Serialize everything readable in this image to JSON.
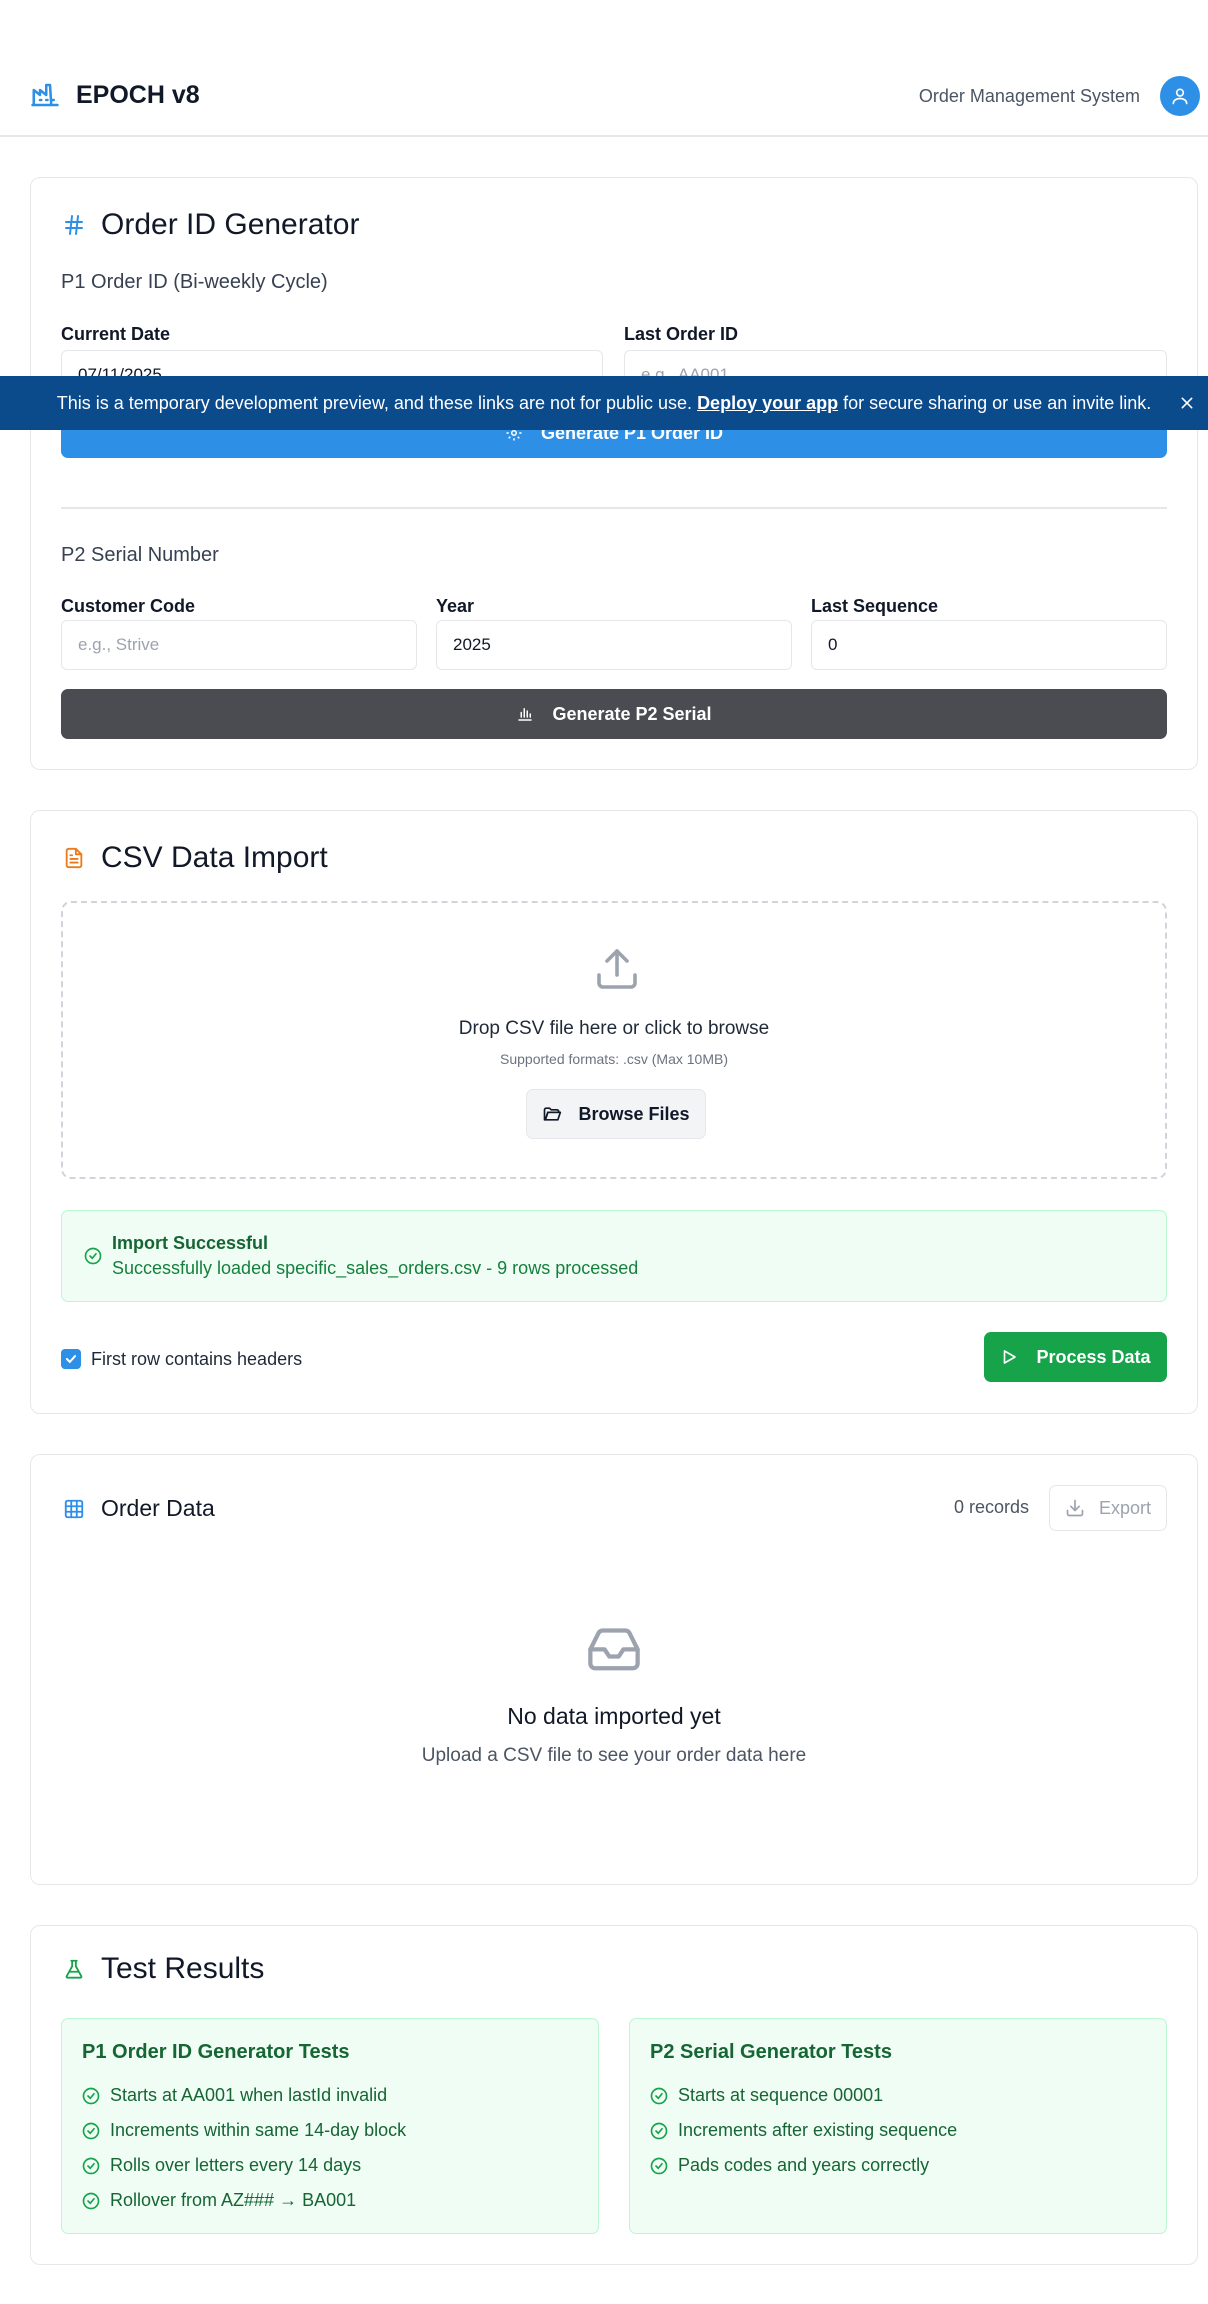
{
  "header": {
    "title": "EPOCH v8",
    "subtitle": "Order Management System"
  },
  "order_generator": {
    "title": "Order ID Generator",
    "p1": {
      "section_label": "P1 Order ID (Bi-weekly Cycle)",
      "current_date_label": "Current Date",
      "current_date_value": "07/11/2025",
      "last_order_label": "Last Order ID",
      "last_order_placeholder": "e.g., AA001",
      "button_label": "Generate P1 Order ID"
    },
    "p2": {
      "section_label": "P2 Serial Number",
      "customer_code_label": "Customer Code",
      "customer_code_placeholder": "e.g., Strive",
      "year_label": "Year",
      "year_value": "2025",
      "last_sequence_label": "Last Sequence",
      "last_sequence_value": "0",
      "button_label": "Generate P2 Serial"
    }
  },
  "csv_import": {
    "title": "CSV Data Import",
    "drop_text": "Drop CSV file here or click to browse",
    "formats_text": "Supported formats: .csv (Max 10MB)",
    "browse_label": "Browse Files",
    "success_title": "Import Successful",
    "success_message": "Successfully loaded specific_sales_orders.csv - 9 rows processed",
    "headers_checkbox_label": "First row contains headers",
    "headers_checked": true,
    "process_label": "Process Data"
  },
  "order_data": {
    "title": "Order Data",
    "records_text": "0 records",
    "export_label": "Export",
    "empty_title": "No data imported yet",
    "empty_subtitle": "Upload a CSV file to see your order data here"
  },
  "test_results": {
    "title": "Test Results",
    "p1": {
      "title": "P1 Order ID Generator Tests",
      "items": [
        "Starts at AA001 when lastId invalid",
        "Increments within same 14-day block",
        "Rolls over letters every 14 days",
        "Rollover from AZ### → BA001"
      ]
    },
    "p2": {
      "title": "P2 Serial Generator Tests",
      "items": [
        "Starts at sequence 00001",
        "Increments after existing sequence",
        "Pads codes and years correctly"
      ]
    }
  },
  "banner": {
    "text_before": "This is a temporary development preview, and these links are not for public use.",
    "link_text": "Deploy your app",
    "text_after": "for secure sharing or use an invite link."
  },
  "colors": {
    "primary": "#2d8fe6",
    "dark_button": "#4b4b52",
    "success_button": "#16a34a",
    "banner": "#0b4a8b"
  }
}
